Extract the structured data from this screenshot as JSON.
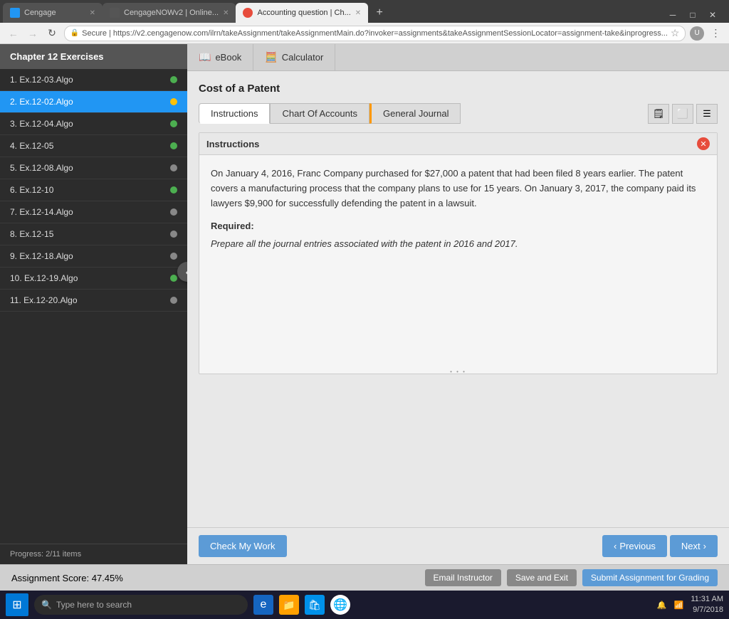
{
  "browser": {
    "tabs": [
      {
        "id": "cengage",
        "label": "Cengage",
        "favicon": "cengage",
        "active": false
      },
      {
        "id": "cnow",
        "label": "CengageNOWv2 | Online...",
        "favicon": "cnow",
        "active": false
      },
      {
        "id": "acct",
        "label": "Accounting question | Ch...",
        "favicon": "acct",
        "active": true
      }
    ],
    "address": "https://v2.cengagenow.com/ilrn/takeAssignment/takeAssignmentMain.do?invoker=assignments&takeAssignmentSessionLocator=assignment-take&inprogress...",
    "address_short": "Secure  |  https://v2.cengagenow.com/ilrn/takeAssignment/takeAssignmentMain.do?invoker=assignments&takeAssignmentSessionLocator=assignment-take&inprogress..."
  },
  "sidebar": {
    "title": "Chapter 12 Exercises",
    "items": [
      {
        "label": "1. Ex.12-03.Algo",
        "dot": "green",
        "active": false
      },
      {
        "label": "2. Ex.12-02.Algo",
        "dot": "yellow",
        "active": true
      },
      {
        "label": "3. Ex.12-04.Algo",
        "dot": "green",
        "active": false
      },
      {
        "label": "4. Ex.12-05",
        "dot": "green",
        "active": false
      },
      {
        "label": "5. Ex.12-08.Algo",
        "dot": "gray",
        "active": false
      },
      {
        "label": "6. Ex.12-10",
        "dot": "green",
        "active": false
      },
      {
        "label": "7. Ex.12-14.Algo",
        "dot": "gray",
        "active": false
      },
      {
        "label": "8. Ex.12-15",
        "dot": "gray",
        "active": false
      },
      {
        "label": "9. Ex.12-18.Algo",
        "dot": "gray",
        "active": false
      },
      {
        "label": "10. Ex.12-19.Algo",
        "dot": "green",
        "active": false
      },
      {
        "label": "11. Ex.12-20.Algo",
        "dot": "gray",
        "active": false
      }
    ],
    "progress_label": "Progress:",
    "progress_value": "2/11 items"
  },
  "header_buttons": [
    {
      "label": "eBook",
      "icon": "📖"
    },
    {
      "label": "Calculator",
      "icon": "🧮"
    }
  ],
  "content": {
    "page_title": "Cost of a Patent",
    "tabs": [
      {
        "label": "Instructions",
        "active": true,
        "warning": false
      },
      {
        "label": "Chart Of Accounts",
        "active": false,
        "warning": false
      },
      {
        "label": "General Journal",
        "active": false,
        "warning": true
      }
    ],
    "tab_icons": [
      "🗒",
      "⬜",
      "☰"
    ],
    "instructions_panel": {
      "title": "Instructions",
      "body_paragraph": "On January 4, 2016, Franc Company purchased for $27,000 a patent that had been filed 8 years earlier. The patent covers a manufacturing process that the company plans to use for 15 years. On January 3, 2017, the company paid its lawyers $9,900 for successfully defending the patent in a lawsuit.",
      "required_label": "Required:",
      "required_text": "Prepare all the journal entries associated with the patent in 2016 and 2017."
    }
  },
  "navigation": {
    "check_btn": "Check My Work",
    "previous_btn": "Previous",
    "next_btn": "Next"
  },
  "score_bar": {
    "label": "Assignment Score:",
    "value": "47.45%",
    "email_btn": "Email Instructor",
    "save_btn": "Save and Exit",
    "submit_btn": "Submit Assignment for Grading"
  },
  "taskbar": {
    "search_placeholder": "Type here to search",
    "time": "11:31 AM",
    "date": "9/7/2018"
  }
}
